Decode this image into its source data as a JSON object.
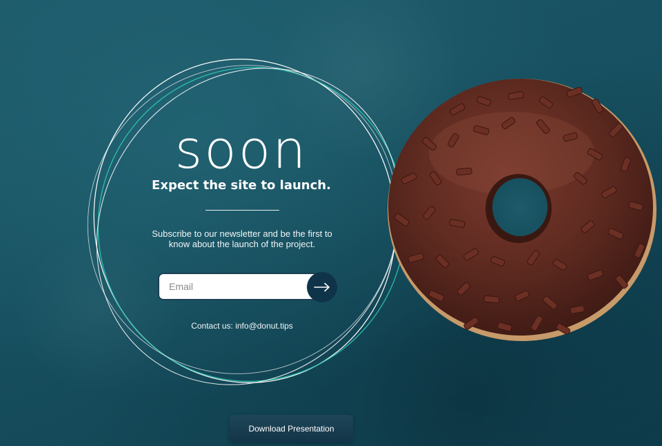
{
  "hero": {
    "headline": "soon",
    "tagline": "Expect the site to launch.",
    "subtext_line1": "Subscribe to our newsletter and be the first to",
    "subtext_line2": "know about the launch of the project."
  },
  "newsletter": {
    "email_placeholder": "Email",
    "email_value": "",
    "submit_icon": "arrow-right-icon"
  },
  "contact": {
    "text": "Contact us: info@donut.tips"
  },
  "footer": {
    "download_label": "Download Presentation"
  },
  "images": {
    "donut": "chocolate-donut-image"
  },
  "colors": {
    "background": "#175060",
    "button_dark": "#0f3449",
    "ring_accent": "#2ec4b0",
    "text": "#ffffff"
  }
}
